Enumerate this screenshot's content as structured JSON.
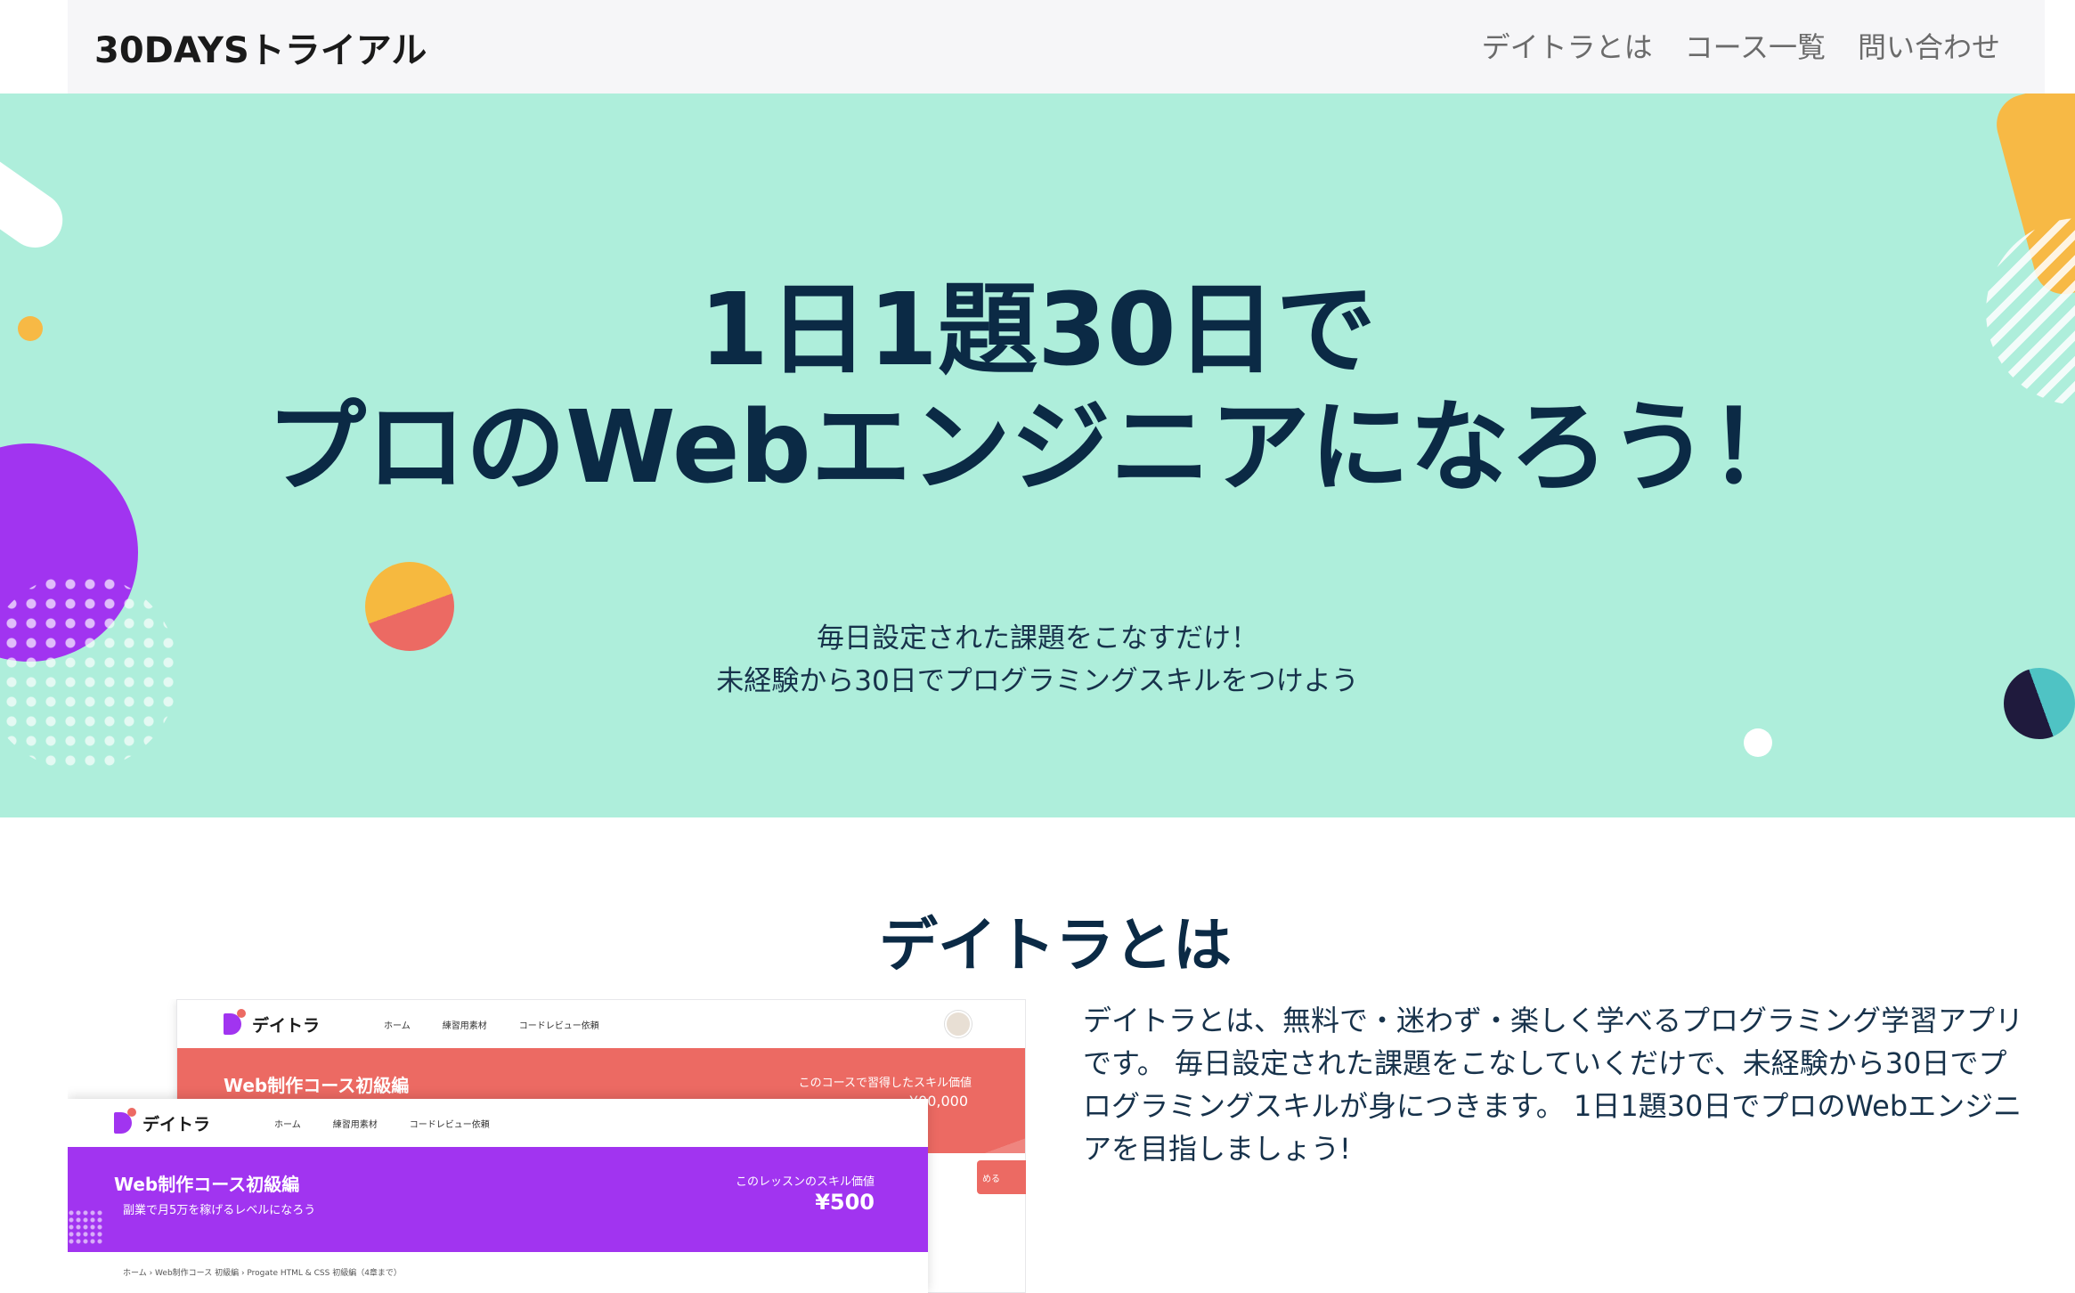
{
  "header": {
    "brand": "30DAYSトライアル",
    "nav": [
      "デイトラとは",
      "コース一覧",
      "問い合わせ"
    ]
  },
  "hero": {
    "title_lines": [
      "1日1題30日で",
      "プロのWebエンジニアになろう！"
    ],
    "subtitle_lines": [
      "毎日設定された課題をこなすだけ！",
      "未経験から30日でプログラミングスキルをつけよう"
    ]
  },
  "about": {
    "title": "デイトラとは",
    "text": "デイトラとは、無料で・迷わず・楽しく学べるプログラミング学習アプリです。 毎日設定された課題をこなしていくだけで、未経験から30日でプログラミングスキルが身につきます。 1日1題30日でプロのWebエンジニアを目指しましょう!"
  },
  "screenshot": {
    "brand": "デイトラ",
    "nav": [
      "ホーム",
      "練習用素材",
      "コードレビュー依頼"
    ],
    "back_card": {
      "title": "Web制作コース初級編",
      "label": "このコースで習得したスキル価値",
      "price": "¥00,000"
    },
    "front_card": {
      "title": "Web制作コース初級編",
      "subtitle": "副業で月5万を稼げるレベルになろう",
      "label": "このレッスンのスキル価値",
      "price": "¥500",
      "breadcrumb": "ホーム  ›  Web制作コース 初級編  ›  Progate HTML & CSS 初級編（4章まで）",
      "cta": "める"
    }
  },
  "colors": {
    "hero_bg": "#aeeedb",
    "navy": "#0b2a45",
    "purple": "#a134f0",
    "coral": "#ec6a63",
    "orange": "#f7b945"
  }
}
